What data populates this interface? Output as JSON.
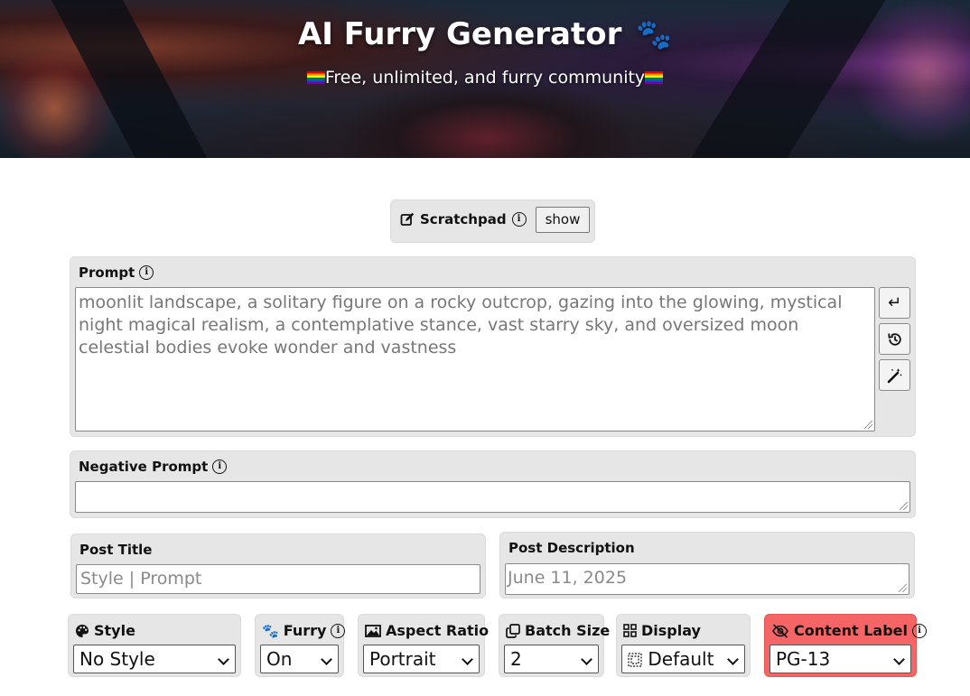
{
  "header": {
    "title": "AI Furry Generator",
    "title_icon": "paw-icon",
    "subtitle": "Free, unlimited, and furry community",
    "subtitle_icon": "rainbow-flag-icon"
  },
  "scratchpad": {
    "label": "Scratchpad",
    "button_label": "show"
  },
  "prompt": {
    "label": "Prompt",
    "value": "moonlit landscape, a solitary figure on a rocky outcrop, gazing into the glowing, mystical night magical realism, a contemplative stance, vast starry sky, and oversized moon celestial bodies evoke wonder and vastness",
    "side_buttons": [
      "enter-icon",
      "history-icon",
      "magic-wand-icon"
    ]
  },
  "negative_prompt": {
    "label": "Negative Prompt",
    "value": ""
  },
  "post_title": {
    "label": "Post Title",
    "placeholder": "Style | Prompt"
  },
  "post_description": {
    "label": "Post Description",
    "placeholder": "June 11, 2025"
  },
  "controls": {
    "style": {
      "label": "Style",
      "icon": "palette-icon",
      "value": "No Style"
    },
    "furry": {
      "label": "Furry",
      "icon": "paw-icon",
      "value": "On"
    },
    "aspect_ratio": {
      "label": "Aspect Ratio",
      "icon": "image-icon",
      "value": "Portrait"
    },
    "batch_size": {
      "label": "Batch Size",
      "icon": "copy-icon",
      "value": "2"
    },
    "display": {
      "label": "Display",
      "icon": "grid-icon",
      "value": "Default",
      "value_icon": "dashed-square-icon"
    },
    "content_label": {
      "label": "Content Label",
      "icon": "eye-slash-icon",
      "value": "PG-13",
      "color": "#f56565"
    }
  }
}
